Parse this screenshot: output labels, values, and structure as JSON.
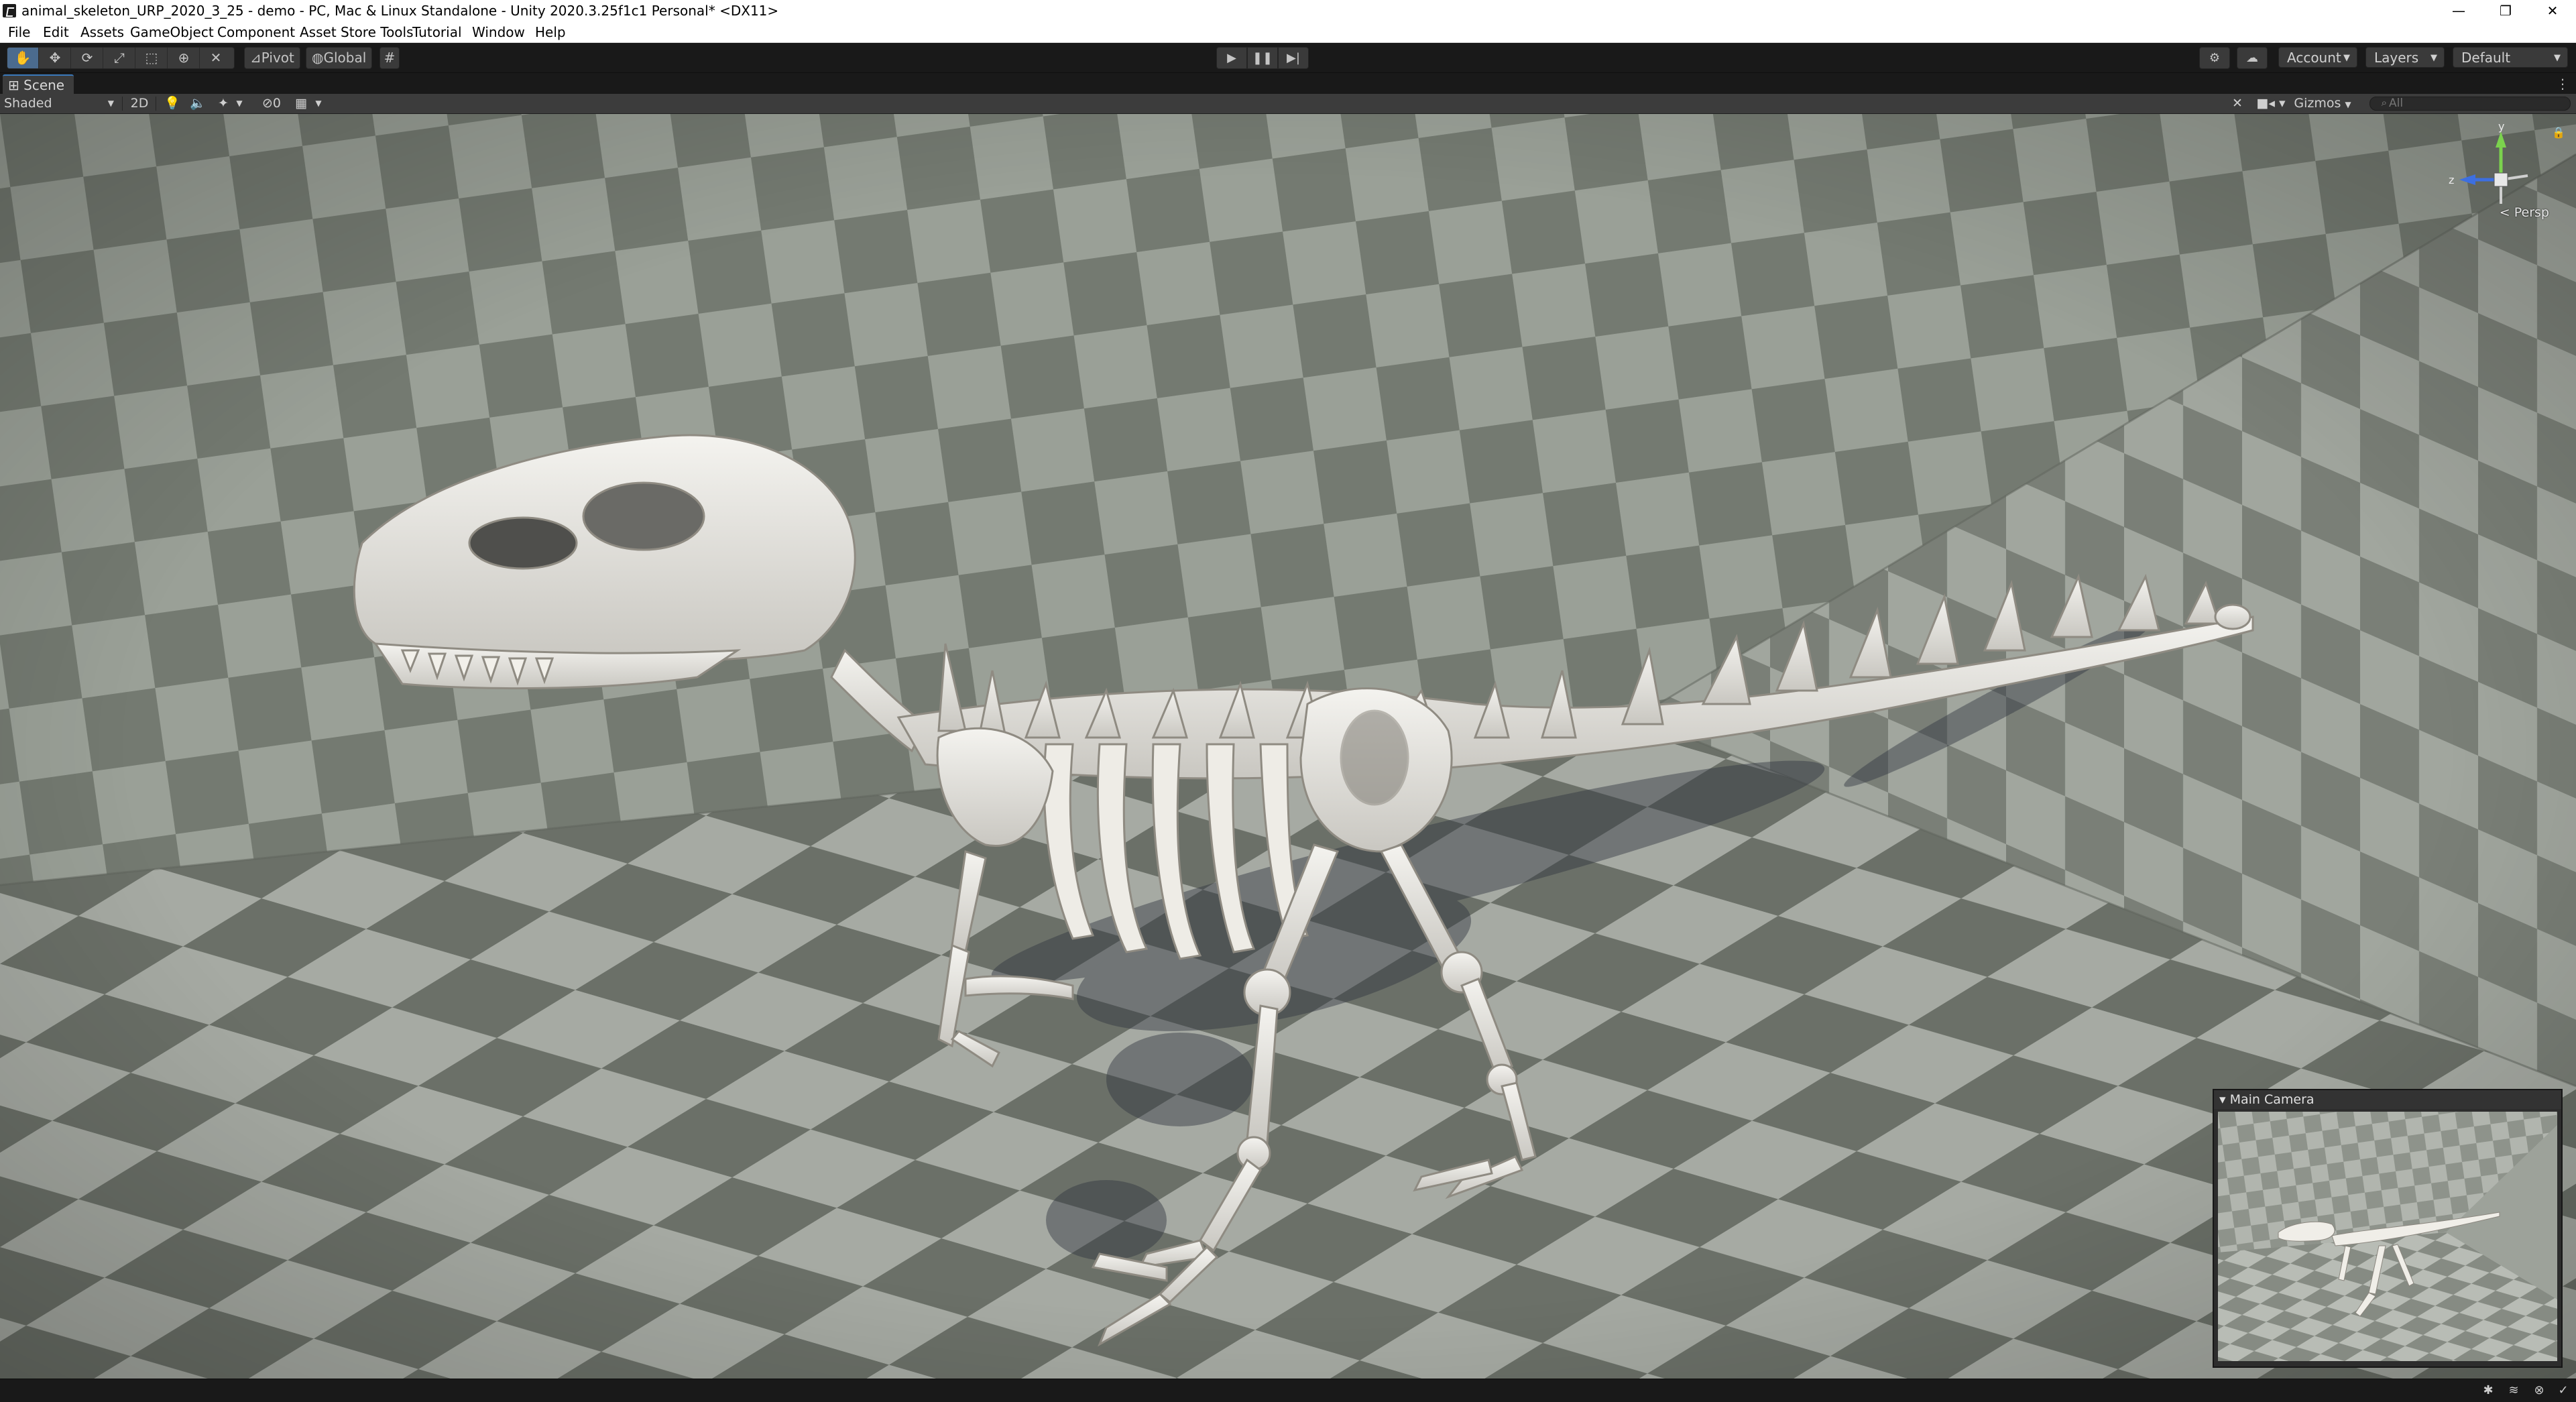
{
  "window": {
    "title": "animal_skeleton_URP_2020_3_25 - demo - PC, Mac & Linux Standalone - Unity 2020.3.25f1c1 Personal* <DX11>",
    "controls": [
      "—",
      "❐",
      "✕"
    ]
  },
  "menu": [
    "File",
    "Edit",
    "Assets",
    "GameObject",
    "Component",
    "Asset Store Tools",
    "Tutorial",
    "Window",
    "Help"
  ],
  "toolbar": {
    "pivot_label": "Pivot",
    "global_label": "Global",
    "account_label": "Account",
    "layers_label": "Layers",
    "layout_label": "Default"
  },
  "scene": {
    "tab_label": "Scene",
    "draw_mode": "Shaded",
    "mode_2d": "2D",
    "hidden_count": "0",
    "gizmos_label": "Gizmos",
    "search_placeholder": "All",
    "projection_label": "< Persp",
    "axis_y": "y",
    "axis_z": "z"
  },
  "camera_preview": {
    "title": "Main Camera"
  },
  "colors": {
    "accent": "#4b6b8e",
    "tab_highlight": "#3a79bb",
    "checker_light": "#a7aba4",
    "checker_dark": "#6f746c",
    "bone": "#e8e6e0"
  }
}
